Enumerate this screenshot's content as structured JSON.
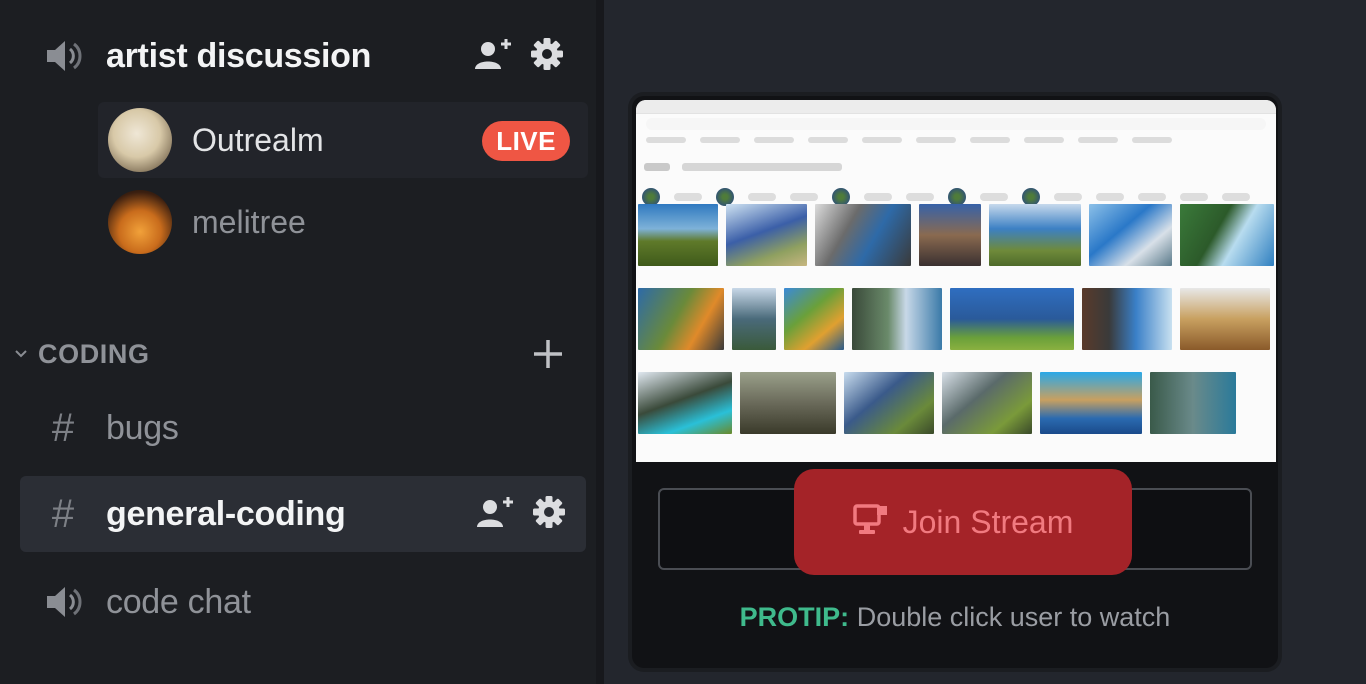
{
  "sidebar": {
    "voice_channel": {
      "name": "artist discussion",
      "icon": "speaker-icon",
      "actions": [
        "invite-icon",
        "gear-icon"
      ]
    },
    "voice_users": [
      {
        "name": "Outrealm",
        "badge": "LIVE",
        "streaming": true
      },
      {
        "name": "melitree",
        "badge": null,
        "streaming": false
      }
    ],
    "category": {
      "label": "CODING",
      "collapse_icon": "chevron-down-icon",
      "add_icon": "plus-icon"
    },
    "channels": [
      {
        "type": "text",
        "name": "bugs",
        "selected": false
      },
      {
        "type": "text",
        "name": "general-coding",
        "selected": true
      },
      {
        "type": "voice",
        "name": "code chat",
        "selected": false
      }
    ]
  },
  "stream": {
    "join_label": "Join Stream",
    "join_icon": "screen-share-icon",
    "protip_label": "PROTIP:",
    "protip_text": " Double click user to watch"
  },
  "colors": {
    "live": "#ef5644",
    "join_button": "#a42328",
    "protip": "#3fba8c"
  }
}
